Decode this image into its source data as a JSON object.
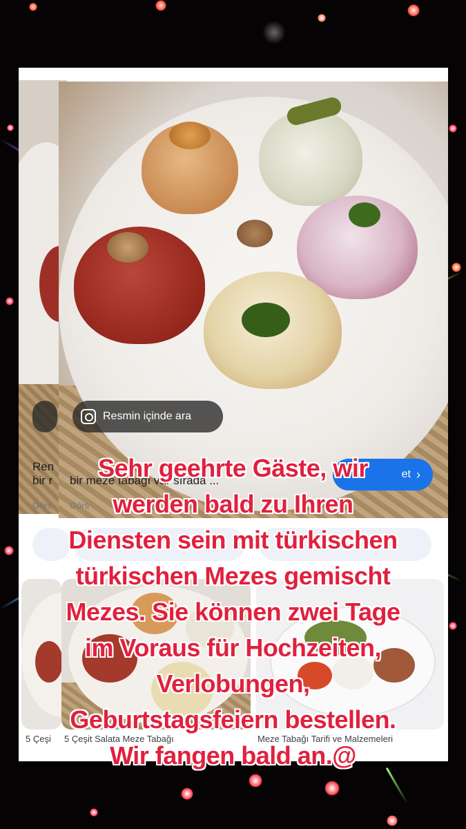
{
  "lens": {
    "label": "Resmin içinde ara",
    "icon": "lens-search-icon"
  },
  "result": {
    "title_line1_left": "Ren",
    "title_line1_mid": "...",
    "title_line2_left": "bir r",
    "title_line2": "bir meze tabağı var sırada ...",
    "source_left": "Görs",
    "source": "Görs",
    "visit_label": "et",
    "visit_icon": "chevron-right-icon"
  },
  "pills": {
    "left": "",
    "right": ""
  },
  "thumbnails": [
    {
      "caption": "5 Çeşi"
    },
    {
      "caption": "5 Çeşit Salata Meze Tabağı"
    },
    {
      "caption": "Meze Tabağı Tarifi ve Malzemeleri"
    }
  ],
  "overlay": {
    "lines": [
      "Sehr geehrte Gäste, wir",
      "werden bald zu Ihren",
      "Diensten sein mit türkischen",
      "türkischen Mezes gemischt",
      "Mezes. Sie können zwei Tage",
      "im Voraus für Hochzeiten,",
      "Verlobungen,",
      "Geburtstagsfeiern bestellen.",
      "Wir fangen bald an.@"
    ]
  },
  "colors": {
    "overlay_text": "#e0213e",
    "button": "#1a73e8",
    "background": "#050304"
  }
}
